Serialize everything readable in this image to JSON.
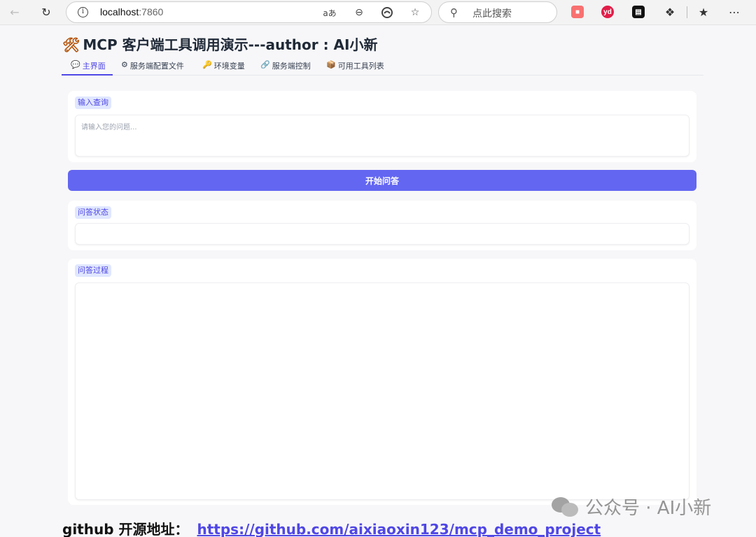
{
  "browser": {
    "url_host": "localhost",
    "url_port": ":7860",
    "search_placeholder": "点此搜索",
    "read_aloud_glyph": "aあ"
  },
  "app": {
    "title": "MCP 客户端工具调用演示---author : AI小新",
    "title_icon": "🛠",
    "tabs": [
      {
        "icon": "💬",
        "label": "主界面"
      },
      {
        "icon": "⚙",
        "label": "服务端配置文件"
      },
      {
        "icon": "🔑",
        "label": "环境变量"
      },
      {
        "icon": "🔗",
        "label": "服务端控制"
      },
      {
        "icon": "📦",
        "label": "可用工具列表"
      }
    ],
    "active_tab": 0,
    "query": {
      "label": "输入查询",
      "placeholder": "请输入您的问题...",
      "value": ""
    },
    "submit_label": "开始问答",
    "status": {
      "label": "问答状态",
      "value": ""
    },
    "process": {
      "label": "问答过程",
      "value": ""
    }
  },
  "footer": {
    "prefix": "github 开源地址：",
    "link": "https://github.com/aixiaoxin123/mcp_demo_project"
  },
  "watermark": {
    "text": "公众号 · AI小新"
  },
  "colors": {
    "accent": "#6366f1",
    "chip_bg": "#e0e7ff",
    "page_bg": "#f7f7f9"
  }
}
